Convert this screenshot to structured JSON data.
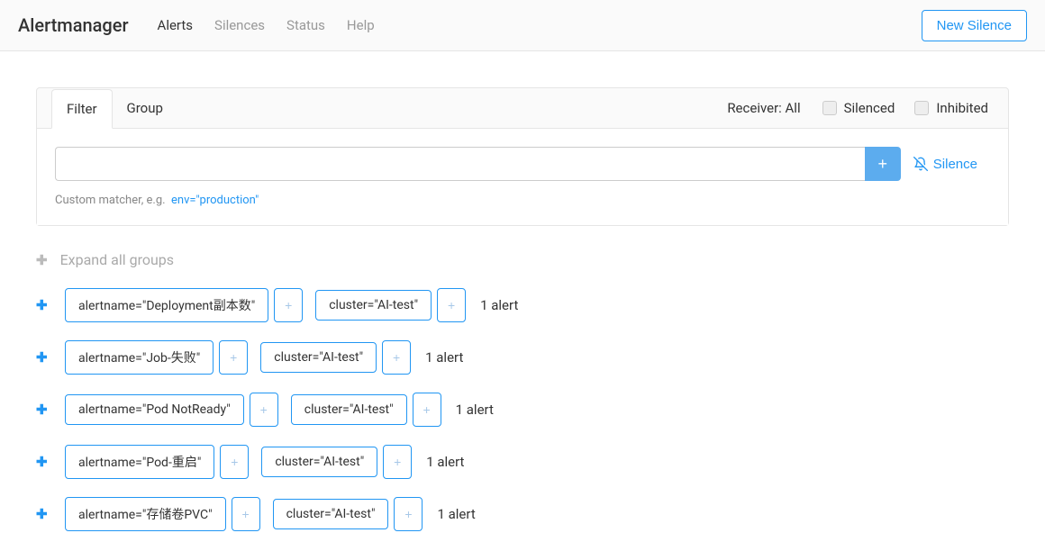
{
  "nav": {
    "brand": "Alertmanager",
    "items": [
      "Alerts",
      "Silences",
      "Status",
      "Help"
    ],
    "new_silence": "New Silence"
  },
  "panel": {
    "tabs": {
      "filter": "Filter",
      "group": "Group"
    },
    "receiver": "Receiver: All",
    "silenced": "Silenced",
    "inhibited": "Inhibited",
    "filter_placeholder": "",
    "silence_btn": "Silence",
    "hint_prefix": "Custom matcher, e.g.",
    "hint_example": "env=\"production\""
  },
  "groups": {
    "expand_all": "Expand all groups",
    "rows": [
      {
        "labels": [
          "alertname=\"Deployment副本数\"",
          "cluster=\"AI-test\""
        ],
        "count": "1 alert"
      },
      {
        "labels": [
          "alertname=\"Job-失败\"",
          "cluster=\"AI-test\""
        ],
        "count": "1 alert"
      },
      {
        "labels": [
          "alertname=\"Pod NotReady\"",
          "cluster=\"AI-test\""
        ],
        "count": "1 alert"
      },
      {
        "labels": [
          "alertname=\"Pod-重启\"",
          "cluster=\"AI-test\""
        ],
        "count": "1 alert"
      },
      {
        "labels": [
          "alertname=\"存储卷PVC\"",
          "cluster=\"AI-test\""
        ],
        "count": "1 alert"
      }
    ]
  }
}
